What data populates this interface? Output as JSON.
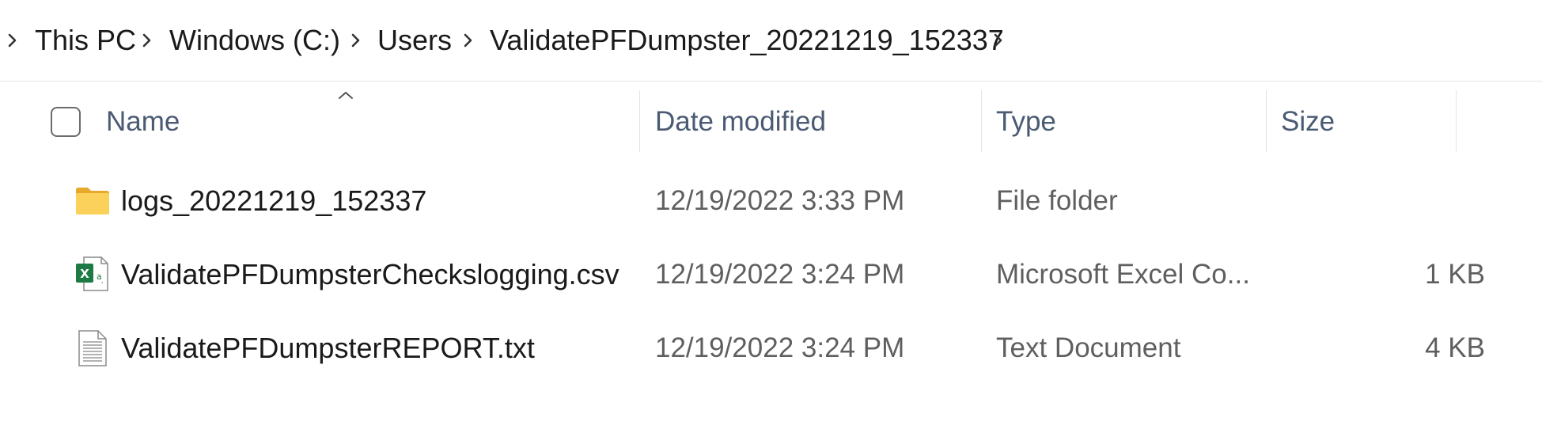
{
  "breadcrumb": {
    "items": [
      {
        "label": "This PC"
      },
      {
        "label": "Windows (C:)"
      },
      {
        "label": "Users"
      },
      {
        "label": "ValidatePFDumpster_20221219_152337"
      }
    ]
  },
  "columns": {
    "name": "Name",
    "date_modified": "Date modified",
    "type": "Type",
    "size": "Size",
    "sorted_by": "name",
    "sort_direction": "ascending"
  },
  "files": [
    {
      "icon": "folder-icon",
      "name": "logs_20221219_152337",
      "date_modified": "12/19/2022 3:33 PM",
      "type": "File folder",
      "size": ""
    },
    {
      "icon": "excel-csv-icon",
      "name": "ValidatePFDumpsterCheckslogging.csv",
      "date_modified": "12/19/2022 3:24 PM",
      "type": "Microsoft Excel Co...",
      "size": "1 KB"
    },
    {
      "icon": "text-document-icon",
      "name": "ValidatePFDumpsterREPORT.txt",
      "date_modified": "12/19/2022 3:24 PM",
      "type": "Text Document",
      "size": "4 KB"
    }
  ],
  "colors": {
    "header_text": "#4a5a73",
    "folder": "#f7c948",
    "excel_green": "#1d7a45"
  }
}
